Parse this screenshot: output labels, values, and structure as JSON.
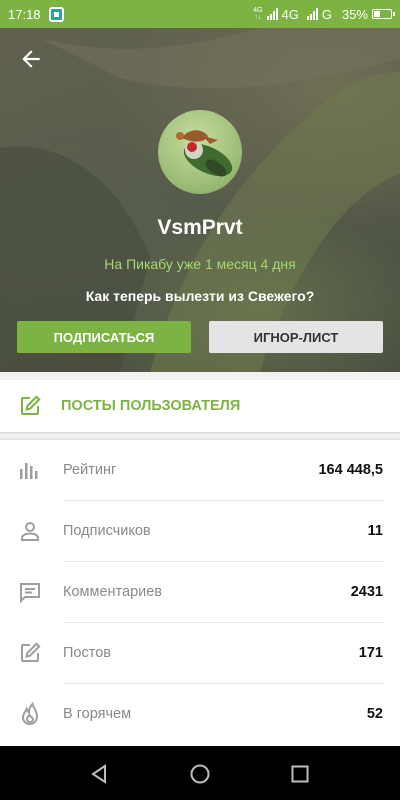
{
  "status_bar": {
    "time": "17:18",
    "network_small_top": "4G",
    "network_small_bottom": "↑↓",
    "network_1": "4G",
    "network_2": "G",
    "battery": "35%"
  },
  "header": {
    "username": "VsmPrvt",
    "member_since": "На Пикабу уже 1 месяц 4 дня",
    "status": "Как теперь вылезти из Свежего?",
    "subscribe_label": "ПОДПИСАТЬСЯ",
    "ignore_label": "ИГНОР-ЛИСТ"
  },
  "posts_link": {
    "label": "ПОСТЫ ПОЛЬЗОВАТЕЛЯ",
    "icon": "edit-icon"
  },
  "stats": [
    {
      "label": "Рейтинг",
      "value": "164 448,5",
      "icon": "rating-icon"
    },
    {
      "label": "Подписчиков",
      "value": "11",
      "icon": "person-icon"
    },
    {
      "label": "Комментариев",
      "value": "2431",
      "icon": "comment-icon"
    },
    {
      "label": "Постов",
      "value": "171",
      "icon": "edit-icon"
    },
    {
      "label": "В горячем",
      "value": "52",
      "icon": "fire-icon"
    }
  ],
  "colors": {
    "accent": "#7cb342",
    "member_since": "#a6d86f",
    "nav": "#000000"
  }
}
